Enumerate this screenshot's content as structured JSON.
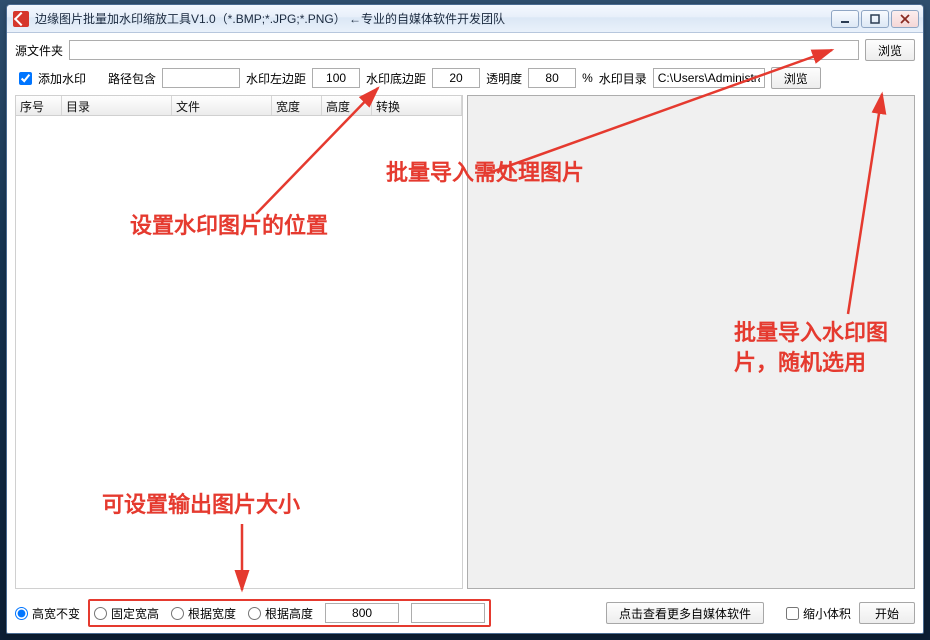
{
  "title": "边缘图片批量加水印缩放工具V1.0（*.BMP;*.JPG;*.PNG）  ←专业的自媒体软件开发团队",
  "source_folder_label": "源文件夹",
  "source_folder_value": "",
  "browse": "浏览",
  "add_watermark_label": "添加水印",
  "path_contains_label": "路径包含",
  "path_contains_value": "",
  "wm_left_label": "水印左边距",
  "wm_left_value": "100",
  "wm_bottom_label": "水印底边距",
  "wm_bottom_value": "20",
  "opacity_label": "透明度",
  "opacity_value": "80",
  "percent": "%",
  "wm_dir_label": "水印目录",
  "wm_dir_value": "C:\\Users\\Administrator",
  "columns": {
    "seq": "序号",
    "dir": "目录",
    "file": "文件",
    "width": "宽度",
    "height": "高度",
    "convert": "转换"
  },
  "size_mode": {
    "keep": "高宽不变",
    "fixed": "固定宽高",
    "by_width": "根据宽度",
    "by_height": "根据高度",
    "val1": "800",
    "val2": ""
  },
  "more_software": "点击查看更多自媒体软件",
  "shrink_label": "缩小体积",
  "start": "开始",
  "annot": {
    "import_images": "批量导入需处理图片",
    "wm_position": "设置水印图片的位置",
    "import_wm": "批量导入水印图片，随机选用",
    "output_size": "可设置输出图片大小"
  }
}
